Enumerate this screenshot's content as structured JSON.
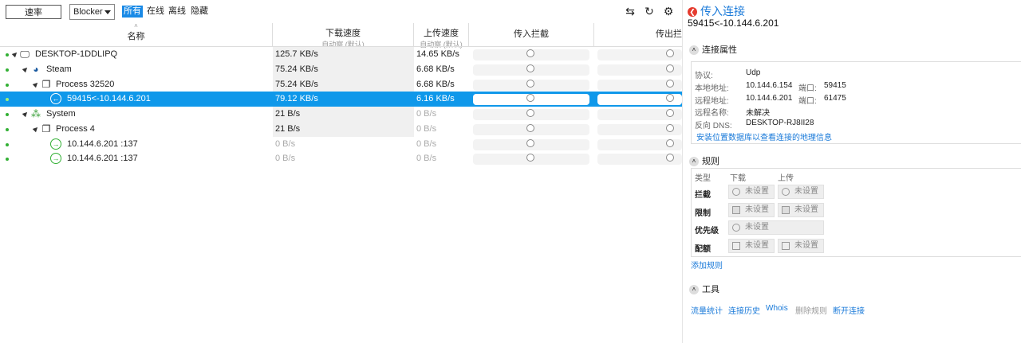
{
  "toolbar": {
    "rate_button": "速率",
    "filter_select": "Blocker",
    "filters": [
      "所有",
      "在线",
      "离线",
      "隐藏"
    ],
    "icons": [
      "swap-icon",
      "refresh-icon",
      "gear-icon"
    ]
  },
  "columns": {
    "name": "名称",
    "download": {
      "title": "下载速度",
      "sub": "自动察 (默认)"
    },
    "upload": {
      "title": "上传速度",
      "sub": "自动察 (默认)"
    },
    "in_block": "传入拦截",
    "out_block": "传出拦"
  },
  "rows": [
    {
      "name": "DESKTOP-1DDLIPQ",
      "dl": "125.7 KB/s",
      "ul": "14.65 KB/s",
      "icon": "computer-icon"
    },
    {
      "name": "Steam",
      "dl": "75.24 KB/s",
      "ul": "6.68 KB/s",
      "icon": "steam-icon"
    },
    {
      "name": "Process 32520",
      "dl": "75.24 KB/s",
      "ul": "6.68 KB/s",
      "icon": "process-icon"
    },
    {
      "name": "59415<-10.144.6.201",
      "dl": "79.12 KB/s",
      "ul": "6.16 KB/s",
      "icon": "incoming-icon"
    },
    {
      "name": "System",
      "dl": "21 B/s",
      "ul": "0 B/s",
      "icon": "system-icon"
    },
    {
      "name": "Process 4",
      "dl": "21 B/s",
      "ul": "0 B/s",
      "icon": "process-icon"
    },
    {
      "name": "10.144.6.201 :137",
      "dl": "0 B/s",
      "ul": "0 B/s",
      "icon": "outgoing-icon"
    },
    {
      "name": "10.144.6.201 :137",
      "dl": "0 B/s",
      "ul": "0 B/s",
      "icon": "outgoing-icon"
    }
  ],
  "panel": {
    "title": "传入连接",
    "subtitle": "59415<-10.144.6.201",
    "props_header": "连接属性",
    "protocol_k": "协议:",
    "protocol_v": "Udp",
    "local_k": "本地地址:",
    "local_v": "10.144.6.154",
    "local_port_k": "端口:",
    "local_port_v": "59415",
    "remote_k": "远程地址:",
    "remote_v": "10.144.6.201",
    "remote_port_k": "端口:",
    "remote_port_v": "61475",
    "rname_k": "远程名称:",
    "rname_v": "未解决",
    "rdns_k": "反向 DNS:",
    "rdns_v": "DESKTOP-RJ8II28",
    "geo_link": "安装位置数据库以查看连接的地理信息",
    "rules_header": "规则",
    "rules_cols": {
      "type": "类型",
      "down": "下载",
      "up": "上传"
    },
    "rules": [
      {
        "label": "拦截",
        "down": "未设置",
        "up": "未设置"
      },
      {
        "label": "限制",
        "down": "未设置",
        "up": "未设置"
      },
      {
        "label": "优先级",
        "down": "未设置"
      },
      {
        "label": "配额",
        "down": "未设置",
        "up": "未设置"
      }
    ],
    "add_rule": "添加规则",
    "tools_header": "工具",
    "tools": [
      "流量统计",
      "连接历史",
      "Whois",
      "删除规则",
      "断开连接"
    ]
  }
}
